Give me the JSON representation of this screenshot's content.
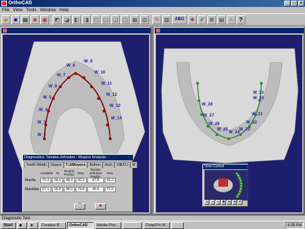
{
  "app": {
    "title": "OrthoCAD"
  },
  "menu": [
    "File",
    "View",
    "Tools",
    "Window",
    "Help"
  ],
  "toolbar": {
    "abo_label": "ABO",
    "help_label": "?"
  },
  "left_view": {
    "tooth_labels": [
      "W_9",
      "W_8",
      "W_10",
      "W_7",
      "W_11",
      "W_6",
      "W_12",
      "W_5",
      "W_13",
      "W_4",
      "W_14",
      "W_3",
      "W_2"
    ]
  },
  "right_view": {
    "tooth_labels": [
      "W_31",
      "W_20",
      "W_28",
      "W_27",
      "W_26",
      "W_25",
      "W_24",
      "W_23",
      "W_22",
      "W_21"
    ]
  },
  "diagnostics": {
    "title": "Diagnostics: Tanaka-Johnston - Moyers Analysis",
    "tabs": [
      "Teeth Width",
      "Space",
      "T-J/Moyers",
      "Bolton",
      "Arch",
      "OB/OJ",
      "M"
    ],
    "headers": [
      "Available",
      "SI",
      "Moyers Predict.",
      "Req.",
      "Tanaka-Johnston Predict.",
      "Req."
    ],
    "rows": [
      {
        "label": "Maxilla",
        "values": [
          "75.3",
          "34.5",
          "48.4",
          "82.9",
          "47.8",
          "82.2"
        ]
      },
      {
        "label": "Mandible",
        "values": [
          "67.1",
          "25.8",
          "48.0",
          "73.8",
          "46.8",
          "72.5"
        ]
      }
    ]
  },
  "view_control": {
    "title": "View Control"
  },
  "status": {
    "text": "Diagnostic Tool"
  },
  "taskbar": {
    "start": "Start",
    "tasks": [
      "Creative R...",
      "OrthoCAD",
      "Adobe Pho...",
      "",
      "Chap07e.W...",
      ""
    ],
    "clock": "4:28 PM"
  }
}
